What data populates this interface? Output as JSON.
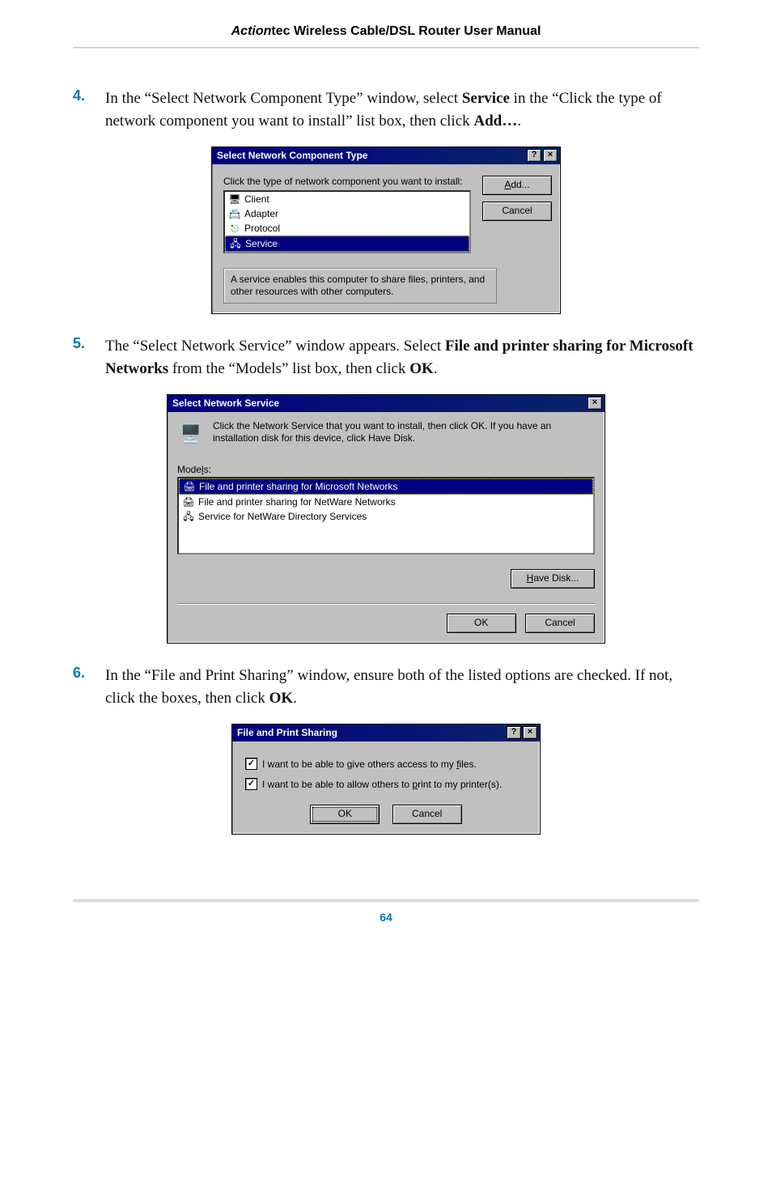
{
  "header": {
    "brand": "Action",
    "brand_suffix": "tec",
    "title_rest": " Wireless Cable/DSL Router User Manual"
  },
  "steps": {
    "s4": {
      "num": "4.",
      "text_pre": "In the “Select Network Component Type” window, select ",
      "bold1": "Service",
      "text_mid": " in the “Click the type of network component you want to install” list box, then click ",
      "bold2": "Add…",
      "text_end": "."
    },
    "s5": {
      "num": "5.",
      "text_pre": "The “Select Network Service” window appears. Select ",
      "bold1": "File and printer sharing for Microsoft Networks",
      "text_mid": " from the “Models” list box, then click ",
      "bold2": "OK",
      "text_end": "."
    },
    "s6": {
      "num": "6.",
      "text_pre": "In the “File and Print Sharing” window, ensure both of the listed options are checked. If not, click the boxes, then click ",
      "bold1": "OK",
      "text_end": "."
    }
  },
  "dlg1": {
    "title": "Select Network Component Type",
    "help_glyph": "?",
    "close_glyph": "×",
    "prompt": "Click the type of network component you want to install:",
    "items": {
      "client": "Client",
      "adapter": "Adapter",
      "protocol": "Protocol",
      "service": "Service"
    },
    "add_btn_pre": "A",
    "add_btn_rest": "dd...",
    "cancel_btn": "Cancel",
    "desc": "A service enables this computer to share files, printers, and other resources with other computers."
  },
  "dlg2": {
    "title": "Select Network Service",
    "close_glyph": "×",
    "intro": "Click the Network Service that you want to install, then click OK. If you have an installation disk for this device, click Have Disk.",
    "models_pre": "Mode",
    "models_ul": "l",
    "models_rest": "s:",
    "items": {
      "ms": "File and printer sharing for Microsoft Networks",
      "nw": "File and printer sharing for NetWare Networks",
      "nds": "Service for NetWare Directory Services"
    },
    "havedisk_pre": "H",
    "havedisk_rest": "ave Disk...",
    "ok_btn": "OK",
    "cancel_btn": "Cancel"
  },
  "dlg3": {
    "title": "File and Print Sharing",
    "help_glyph": "?",
    "close_glyph": "×",
    "opt1_pre": "I want to be able to give others access to my ",
    "opt1_ul": "f",
    "opt1_rest": "iles.",
    "opt2_pre": "I want to be able to allow others to ",
    "opt2_ul": "p",
    "opt2_rest": "rint to my printer(s).",
    "ok_btn": "OK",
    "cancel_btn": "Cancel"
  },
  "page_number": "64"
}
